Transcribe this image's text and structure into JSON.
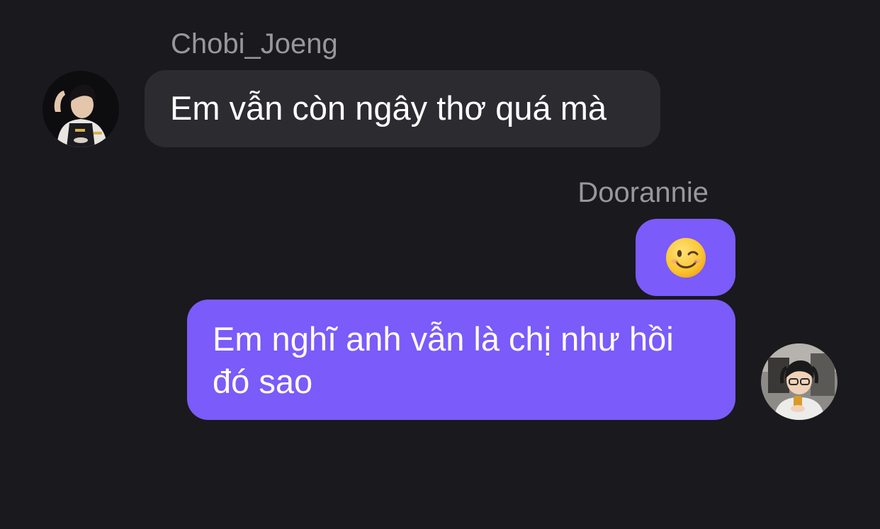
{
  "conversation": {
    "incoming": {
      "sender_name": "Chobi_Joeng",
      "message": "Em vẫn còn ngây thơ quá mà"
    },
    "outgoing": {
      "sender_name": "Doorannie",
      "emoji_message": "winking-face-emoji",
      "message": "Em nghĩ anh vẫn là chị như hồi đó sao"
    }
  },
  "colors": {
    "background": "#1a191d",
    "incoming_bubble": "#2c2b30",
    "outgoing_bubble": "#7b5bf9",
    "sender_name": "#98979c",
    "message_text": "#ffffff"
  }
}
